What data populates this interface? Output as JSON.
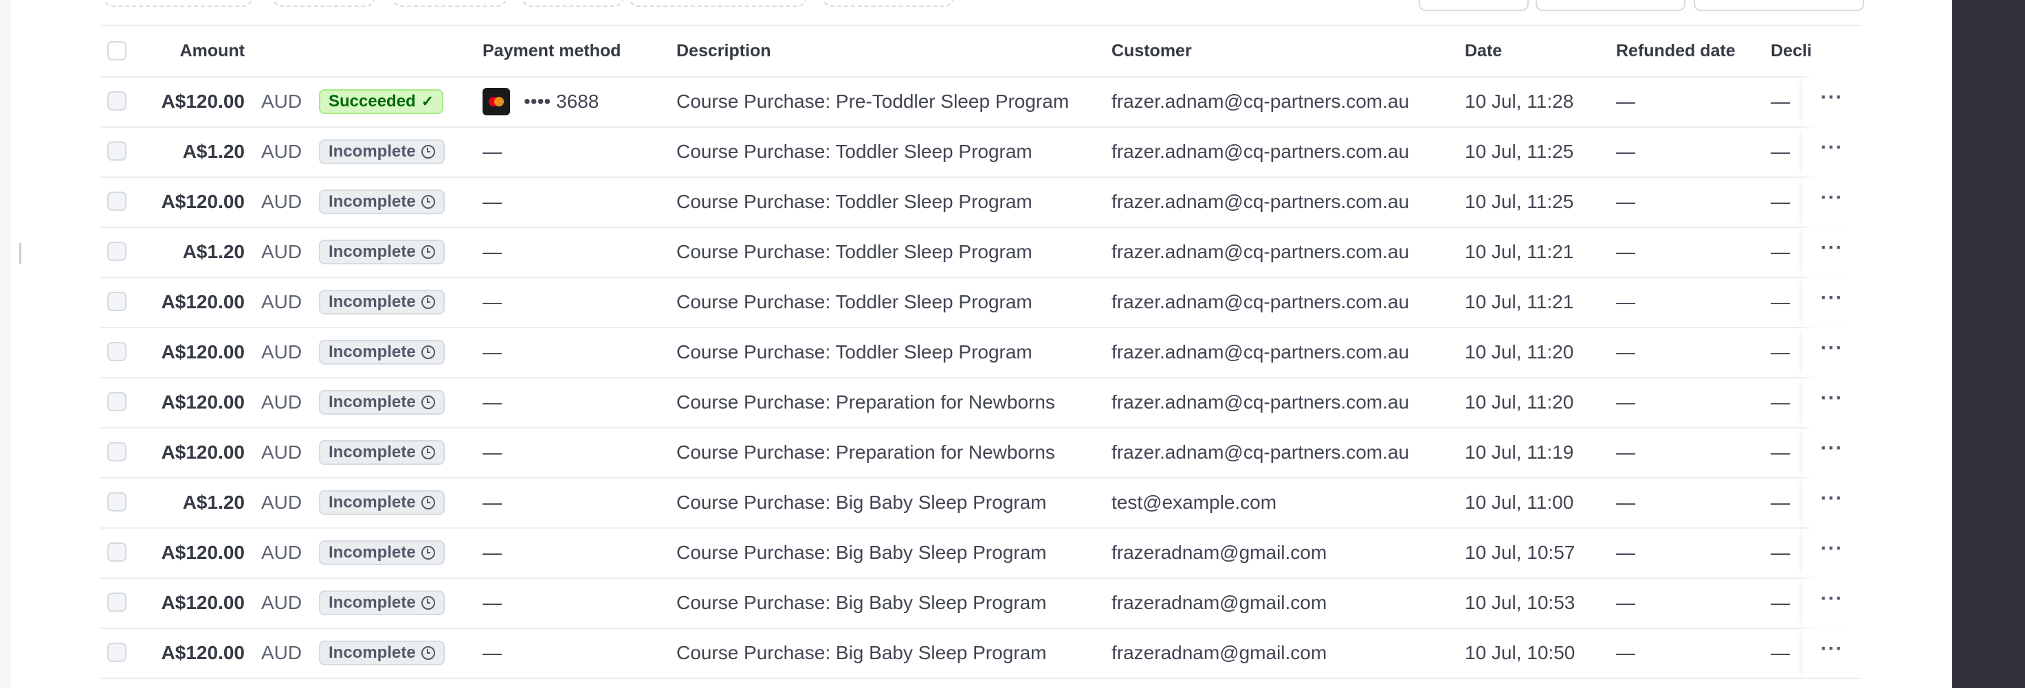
{
  "table": {
    "headers": {
      "amount": "Amount",
      "payment_method": "Payment method",
      "description": "Description",
      "customer": "Customer",
      "date": "Date",
      "refunded_date": "Refunded date",
      "declined": "Decli"
    },
    "rows": [
      {
        "amount": "A$120.00",
        "currency": "AUD",
        "status": "Succeeded",
        "status_type": "succeeded",
        "payment": "•••• 3688",
        "card_brand": "mastercard-icon",
        "description": "Course Purchase: Pre-Toddler Sleep Program",
        "customer": "frazer.adnam@cq-partners.com.au",
        "date": "10 Jul, 11:28",
        "refunded": "—",
        "declined": "—"
      },
      {
        "amount": "A$1.20",
        "currency": "AUD",
        "status": "Incomplete",
        "status_type": "incomplete",
        "payment": "—",
        "description": "Course Purchase: Toddler Sleep Program",
        "customer": "frazer.adnam@cq-partners.com.au",
        "date": "10 Jul, 11:25",
        "refunded": "—",
        "declined": "—"
      },
      {
        "amount": "A$120.00",
        "currency": "AUD",
        "status": "Incomplete",
        "status_type": "incomplete",
        "payment": "—",
        "description": "Course Purchase: Toddler Sleep Program",
        "customer": "frazer.adnam@cq-partners.com.au",
        "date": "10 Jul, 11:25",
        "refunded": "—",
        "declined": "—"
      },
      {
        "amount": "A$1.20",
        "currency": "AUD",
        "status": "Incomplete",
        "status_type": "incomplete",
        "payment": "—",
        "description": "Course Purchase: Toddler Sleep Program",
        "customer": "frazer.adnam@cq-partners.com.au",
        "date": "10 Jul, 11:21",
        "refunded": "—",
        "declined": "—"
      },
      {
        "amount": "A$120.00",
        "currency": "AUD",
        "status": "Incomplete",
        "status_type": "incomplete",
        "payment": "—",
        "description": "Course Purchase: Toddler Sleep Program",
        "customer": "frazer.adnam@cq-partners.com.au",
        "date": "10 Jul, 11:21",
        "refunded": "—",
        "declined": "—"
      },
      {
        "amount": "A$120.00",
        "currency": "AUD",
        "status": "Incomplete",
        "status_type": "incomplete",
        "payment": "—",
        "description": "Course Purchase: Toddler Sleep Program",
        "customer": "frazer.adnam@cq-partners.com.au",
        "date": "10 Jul, 11:20",
        "refunded": "—",
        "declined": "—"
      },
      {
        "amount": "A$120.00",
        "currency": "AUD",
        "status": "Incomplete",
        "status_type": "incomplete",
        "payment": "—",
        "description": "Course Purchase: Preparation for Newborns",
        "customer": "frazer.adnam@cq-partners.com.au",
        "date": "10 Jul, 11:20",
        "refunded": "—",
        "declined": "—"
      },
      {
        "amount": "A$120.00",
        "currency": "AUD",
        "status": "Incomplete",
        "status_type": "incomplete",
        "payment": "—",
        "description": "Course Purchase: Preparation for Newborns",
        "customer": "frazer.adnam@cq-partners.com.au",
        "date": "10 Jul, 11:19",
        "refunded": "—",
        "declined": "—"
      },
      {
        "amount": "A$1.20",
        "currency": "AUD",
        "status": "Incomplete",
        "status_type": "incomplete",
        "payment": "—",
        "description": "Course Purchase: Big Baby Sleep Program",
        "customer": "test@example.com",
        "date": "10 Jul, 11:00",
        "refunded": "—",
        "declined": "—"
      },
      {
        "amount": "A$120.00",
        "currency": "AUD",
        "status": "Incomplete",
        "status_type": "incomplete",
        "payment": "—",
        "description": "Course Purchase: Big Baby Sleep Program",
        "customer": "frazeradnam@gmail.com",
        "date": "10 Jul, 10:57",
        "refunded": "—",
        "declined": "—"
      },
      {
        "amount": "A$120.00",
        "currency": "AUD",
        "status": "Incomplete",
        "status_type": "incomplete",
        "payment": "—",
        "description": "Course Purchase: Big Baby Sleep Program",
        "customer": "frazeradnam@gmail.com",
        "date": "10 Jul, 10:53",
        "refunded": "—",
        "declined": "—"
      },
      {
        "amount": "A$120.00",
        "currency": "AUD",
        "status": "Incomplete",
        "status_type": "incomplete",
        "payment": "—",
        "description": "Course Purchase: Big Baby Sleep Program",
        "customer": "frazeradnam@gmail.com",
        "date": "10 Jul, 10:50",
        "refunded": "—",
        "declined": "—"
      }
    ]
  },
  "colors": {
    "succeeded_bg": "#d7f7c2",
    "succeeded_text": "#006908",
    "incomplete_bg": "#ebeef1",
    "incomplete_text": "#545969"
  }
}
